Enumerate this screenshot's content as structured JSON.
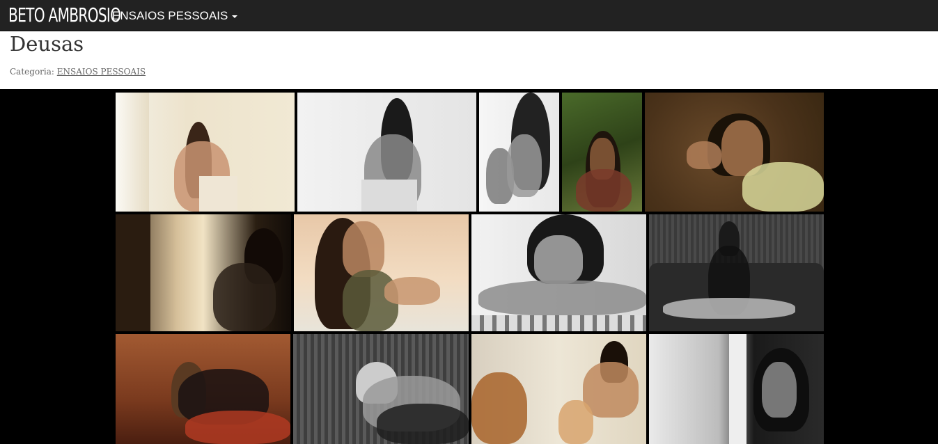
{
  "navbar": {
    "brand": "BETO AMBROSIO",
    "menu_label": "ENSAIOS PESSOAIS"
  },
  "page": {
    "title": "Deusas",
    "category_prefix": "Categoria:",
    "category_link": "ENSAIOS PESSOAIS"
  },
  "gallery": {
    "rows": 3,
    "photos_per_row": [
      5,
      4,
      4
    ],
    "tones": [
      "warm-cream",
      "grayscale-light",
      "grayscale-light",
      "green-forest",
      "brown-leaves",
      "warm-amber",
      "warm-peach",
      "grayscale-light",
      "grayscale-dark",
      "red-wood",
      "grayscale-dark",
      "warm-light",
      "grayscale-light"
    ]
  }
}
